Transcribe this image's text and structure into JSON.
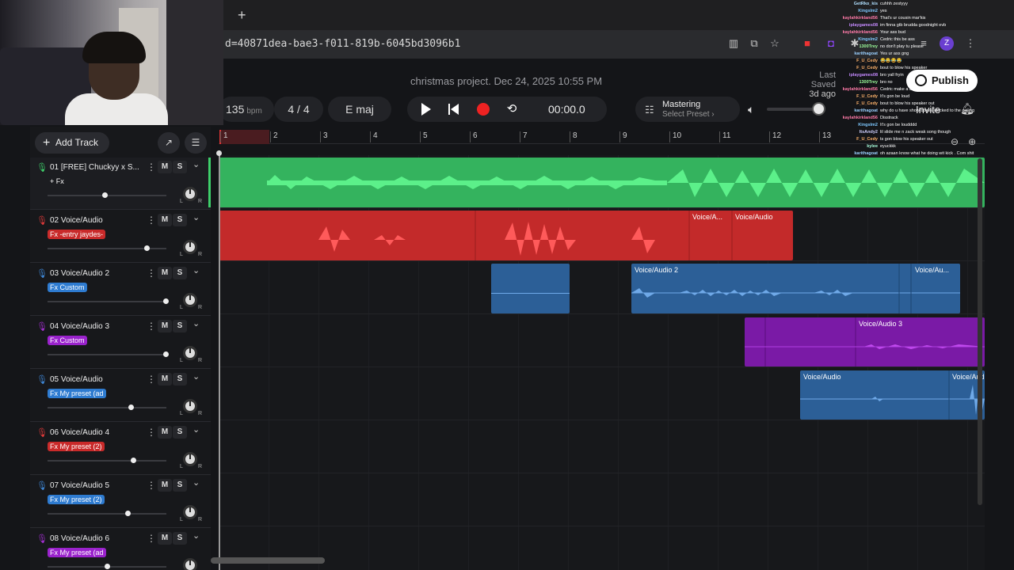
{
  "browser": {
    "new_tab": "+",
    "url": "d=40871dea-bae3-f011-819b-6045bd3096b1",
    "profile_initial": "Z"
  },
  "header": {
    "project_title": "christmas project. Dec 24, 2025 10:55 PM",
    "last_saved_label": "Last Saved",
    "last_saved_value": "3d ago",
    "publish_label": "Publish",
    "invite_label": "Invite"
  },
  "transport": {
    "tempo": "135",
    "tempo_unit": "bpm",
    "time_signature": "4 / 4",
    "key": "E maj",
    "timecode": "00:00.0",
    "mastering_title": "Mastering",
    "mastering_preset": "Select Preset ›",
    "volume": 0.9
  },
  "toolbar": {
    "add_track_label": "Add Track"
  },
  "ruler": {
    "bars": [
      "1",
      "2",
      "3",
      "4",
      "5",
      "6",
      "7",
      "8",
      "9",
      "10",
      "11",
      "12",
      "13"
    ]
  },
  "tracks": [
    {
      "number": "01",
      "name": "[FREE] Chuckyy x S...",
      "fx": "+ Fx",
      "color": "#3ecf6a",
      "fx_bg": "transparent",
      "fader": 0.48,
      "mute": "M",
      "solo": "S"
    },
    {
      "number": "02",
      "name": "Voice/Audio",
      "fx": "Fx -entry jaydes-",
      "color": "#e03a3a",
      "fx_bg": "#c92a2a",
      "fader": 0.83,
      "mute": "M",
      "solo": "S"
    },
    {
      "number": "03",
      "name": "Voice/Audio 2",
      "fx": "Fx Custom",
      "color": "#3f87d6",
      "fx_bg": "#2e7bd0",
      "fader": 0.99,
      "mute": "M",
      "solo": "S"
    },
    {
      "number": "04",
      "name": "Voice/Audio 3",
      "fx": "Fx Custom",
      "color": "#a32fd0",
      "fx_bg": "#9a22cc",
      "fader": 0.99,
      "mute": "M",
      "solo": "S"
    },
    {
      "number": "05",
      "name": "Voice/Audio",
      "fx": "Fx My preset (ad",
      "color": "#3f87d6",
      "fx_bg": "#2e7bd0",
      "fader": 0.7,
      "mute": "M",
      "solo": "S"
    },
    {
      "number": "06",
      "name": "Voice/Audio 4",
      "fx": "Fx My preset (2)",
      "color": "#e03a3a",
      "fx_bg": "#c92a2a",
      "fader": 0.72,
      "mute": "M",
      "solo": "S"
    },
    {
      "number": "07",
      "name": "Voice/Audio 5",
      "fx": "Fx My preset (2)",
      "color": "#3f87d6",
      "fx_bg": "#2e7bd0",
      "fader": 0.67,
      "mute": "M",
      "solo": "S"
    },
    {
      "number": "08",
      "name": "Voice/Audio 6",
      "fx": "Fx My preset (ad",
      "color": "#a32fd0",
      "fx_bg": "#9a22cc",
      "fader": 0.5,
      "mute": "M",
      "solo": "S"
    }
  ],
  "clips": {
    "c2a": "Voice/A...",
    "c2b": "Voice/Audio",
    "c3a": "Voice/Audio 2",
    "c3b": "Voice/Au...",
    "c4a": "Voice/Audio 3",
    "c5a": "Voice/Audio",
    "c5b": "Voice/Audi"
  },
  "chat": [
    {
      "user": "GetRko_kis",
      "msg": "cuhhh zestyyy",
      "color": "#b0e0ff"
    },
    {
      "user": "Kingslm2",
      "msg": "yes",
      "color": "#7ec8ff"
    },
    {
      "user": "kaylahkirkland56",
      "msg": "That's ur cousin mar'kis",
      "color": "#ff7aa8"
    },
    {
      "user": "iplaygames08",
      "msg": "im finna gtb brudda goodnight evb",
      "color": "#c58aff"
    },
    {
      "user": "kaylahkirkland56",
      "msg": "Your ass bud",
      "color": "#ff7aa8"
    },
    {
      "user": "Kingslm2",
      "msg": "Cedric this be ass",
      "color": "#7ec8ff"
    },
    {
      "user": "1300Trey",
      "msg": "no don't play tu please",
      "color": "#9cff9c"
    },
    {
      "user": "karithagoat",
      "msg": "Yes ur ass gng",
      "color": "#9ad0ff"
    },
    {
      "user": "F_U_Cedy",
      "msg": "😂😂😂😂",
      "color": "#ffb36b"
    },
    {
      "user": "F_U_Cedy",
      "msg": "bout to blow his speaker",
      "color": "#ffb36b"
    },
    {
      "user": "iplaygames08",
      "msg": "bro yall fryin",
      "color": "#c58aff"
    },
    {
      "user": "1300Trey",
      "msg": "bro no",
      "color": "#9cff9c"
    },
    {
      "user": "kaylahkirkland56",
      "msg": "Cedric make a diss track",
      "color": "#ff7aa8"
    },
    {
      "user": "F_U_Cedy",
      "msg": "It's gon be loud",
      "color": "#ffb36b"
    },
    {
      "user": "F_U_Cedy",
      "msg": "bout to blow his speaker out",
      "color": "#ffb36b"
    },
    {
      "user": "karithagoat",
      "msg": "why do u have show boxes stacked to the ceiling",
      "color": "#9ad0ff"
    },
    {
      "user": "kaylahkirkland56",
      "msg": "Disstrack",
      "color": "#ff7aa8"
    },
    {
      "user": "Kingslm2",
      "msg": "It's gon be loudddd",
      "color": "#7ec8ff"
    },
    {
      "user": "ItsAndy2",
      "msg": "lil slide me n zack weak song though",
      "color": "#d0d0ff"
    },
    {
      "user": "F_U_Cedy",
      "msg": "ts gon blow his speaker out",
      "color": "#ffb36b"
    },
    {
      "user": "kylee",
      "msg": "eyuckkk",
      "color": "#aaffdd"
    },
    {
      "user": "karithagoat",
      "msg": "oh azaan know what he doing wit kick . Com shit",
      "color": "#9ad0ff"
    }
  ]
}
